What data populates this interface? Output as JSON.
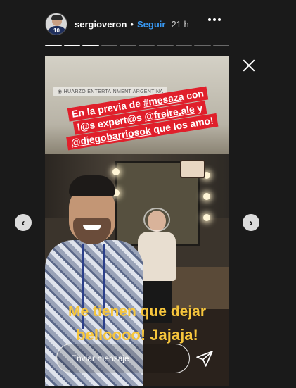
{
  "header": {
    "username": "sergioveron",
    "separator": "•",
    "follow_label": "Seguir",
    "time": "21 h",
    "avatar_number": "10"
  },
  "progress": {
    "total_segments": 10,
    "current_segment": 3
  },
  "story": {
    "location_tag": "◉ HUARZO ENTERTAINMENT ARGENTINA",
    "caption_lines": [
      [
        "En la previa de ",
        "#mesaza",
        " con"
      ],
      [
        "l@s expert@s ",
        "@freire.ale",
        " y"
      ],
      [
        "",
        "@diegobarriosok",
        " que los amo!"
      ]
    ],
    "overlay_text_line1": "Me tienen que dejar",
    "overlay_text_line2": "belloooo! Jajaja!"
  },
  "reply": {
    "placeholder": "Enviar mensaje"
  },
  "icons": {
    "more": "more-options-icon",
    "close": "close-icon",
    "prev": "chevron-left-icon",
    "next": "chevron-right-icon",
    "send": "send-icon"
  },
  "colors": {
    "background": "#1a1a1a",
    "follow": "#3897f0",
    "caption_bg": "#e01f2b",
    "overlay_text": "#f7c63c"
  }
}
